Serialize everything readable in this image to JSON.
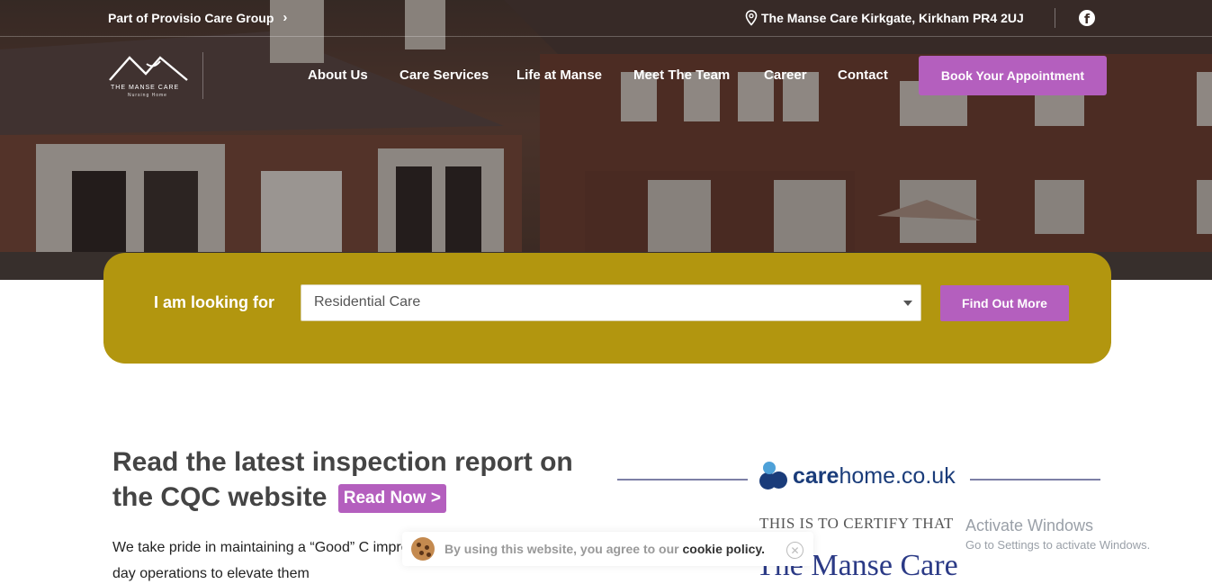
{
  "topbar": {
    "group_link": "Part of Provisio Care Group",
    "address": "The Manse Care Kirkgate, Kirkham PR4 2UJ",
    "social_icon": "facebook-icon"
  },
  "logo": {
    "name": "THE MANSE CARE",
    "subtitle": "Nursing Home"
  },
  "nav": {
    "items": [
      "About Us",
      "Care Services",
      "Life at Manse",
      "Meet The Team",
      "Career",
      "Contact"
    ],
    "cta": "Book Your Appointment"
  },
  "search": {
    "label": "I am looking for",
    "selected": "Residential Care",
    "button": "Find Out More"
  },
  "inspection": {
    "headline": "Read the latest inspection report on the CQC website",
    "cta": "Read Now >",
    "body": "We take pride in maintaining a “Good” C improve every aspect of our day to day operations to elevate them"
  },
  "certificate": {
    "brand_prefix": "care",
    "brand_suffix": "home.co.uk",
    "certify_text": "THIS IS TO CERTIFY THAT",
    "name": "The Manse Care"
  },
  "os_watermark": {
    "title": "Activate Windows",
    "subtitle": "Go to Settings to activate Windows."
  },
  "cookie": {
    "text": "By using this website, you agree to our ",
    "link": "cookie policy."
  },
  "colors": {
    "accent": "#b45fbe",
    "panel": "#b2960f",
    "heading": "#444444"
  }
}
